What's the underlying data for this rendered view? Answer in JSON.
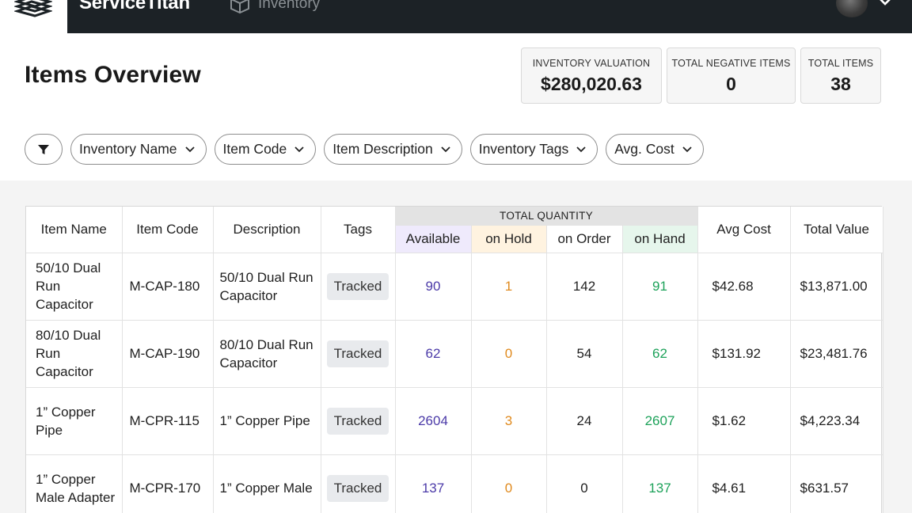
{
  "brand": "ServiceTitan",
  "nav": {
    "inventory_label": "Inventory"
  },
  "page": {
    "title": "Items Overview"
  },
  "stats": [
    {
      "label": "INVENTORY VALUATION",
      "value": "$280,020.63"
    },
    {
      "label": "TOTAL NEGATIVE ITEMS",
      "value": "0"
    },
    {
      "label": "TOTAL ITEMS",
      "value": "38"
    }
  ],
  "filters": [
    {
      "label": "Inventory Name"
    },
    {
      "label": "Item Code"
    },
    {
      "label": "Item Description"
    },
    {
      "label": "Inventory Tags"
    },
    {
      "label": "Avg. Cost"
    }
  ],
  "table": {
    "headers": {
      "item_name": "Item Name",
      "item_code": "Item Code",
      "description": "Description",
      "tags": "Tags",
      "total_quantity": "TOTAL QUANTITY",
      "available": "Available",
      "on_hold": "on Hold",
      "on_order": "on Order",
      "on_hand": "on Hand",
      "avg_cost": "Avg Cost",
      "total_value": "Total Value"
    },
    "rows": [
      {
        "name": "50/10 Dual Run Capacitor",
        "code": "M-CAP-180",
        "description": "50/10 Dual Run Capacitor",
        "tag": "Tracked",
        "available": "90",
        "on_hold": "1",
        "on_order": "142",
        "on_hand": "91",
        "avg_cost": "$42.68",
        "total_value": "$13,871.00"
      },
      {
        "name": "80/10 Dual Run Capacitor",
        "code": "M-CAP-190",
        "description": "80/10 Dual Run Capacitor",
        "tag": "Tracked",
        "available": "62",
        "on_hold": "0",
        "on_order": "54",
        "on_hand": "62",
        "avg_cost": "$131.92",
        "total_value": "$23,481.76"
      },
      {
        "name": "1” Copper Pipe",
        "code": "M-CPR-115",
        "description": "1” Copper Pipe",
        "tag": "Tracked",
        "available": "2604",
        "on_hold": "3",
        "on_order": "24",
        "on_hand": "2607",
        "avg_cost": "$1.62",
        "total_value": "$4,223.34"
      },
      {
        "name": "1” Copper Male Adapter",
        "code": "M-CPR-170",
        "description": "1” Copper Male",
        "tag": "Tracked",
        "available": "137",
        "on_hold": "0",
        "on_order": "0",
        "on_hand": "137",
        "avg_cost": "$4.61",
        "total_value": "$631.57"
      }
    ]
  },
  "colors": {
    "topbar": "#1c2226",
    "available": "#4b3aa8",
    "on_hold": "#e08a1e",
    "on_hand": "#1da25a"
  },
  "icons": [
    "brand-logo-icon",
    "inventory-box-icon",
    "avatar",
    "chevron-down-icon",
    "filter-funnel-icon"
  ]
}
